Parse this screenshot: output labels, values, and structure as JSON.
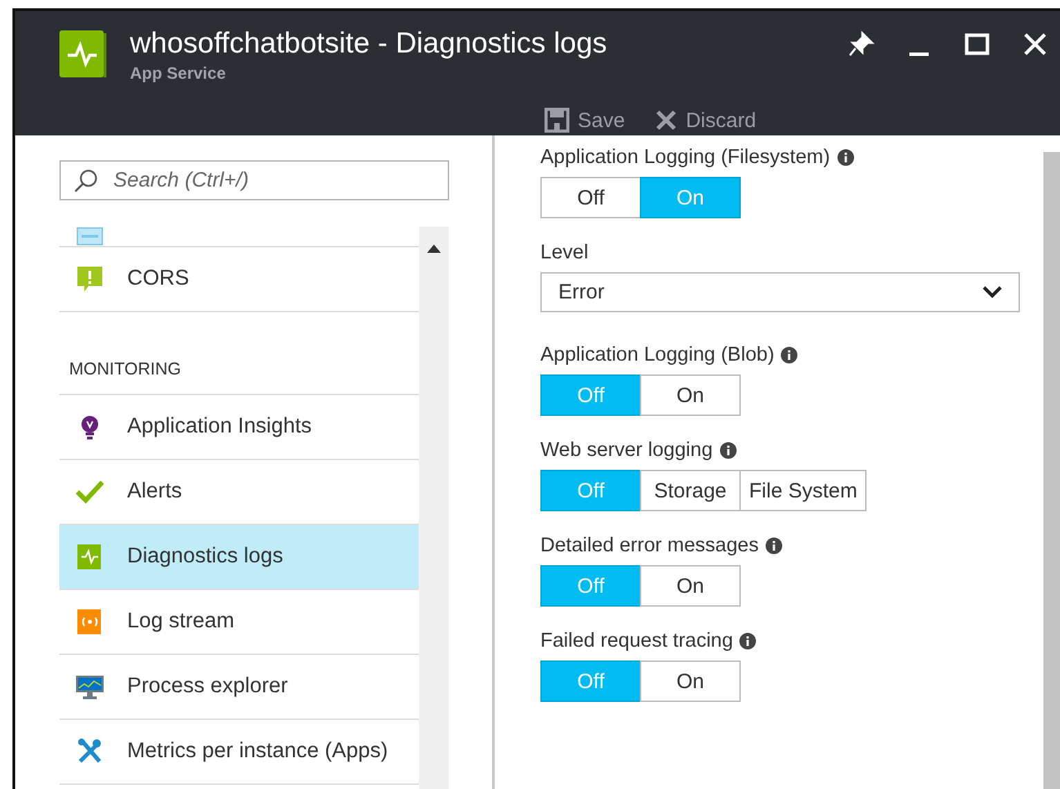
{
  "window": {
    "title": "whosoffchatbotsite - Diagnostics logs",
    "subtitle": "App Service"
  },
  "toolbar": [
    {
      "kind": "save",
      "label": "Save"
    },
    {
      "kind": "discard",
      "label": "Discard"
    }
  ],
  "sidebar": {
    "search": {
      "placeholder": "Search (Ctrl+/)"
    },
    "items": [
      {
        "kind": "item",
        "selected": false
      },
      {
        "kind": "item",
        "label": "CORS",
        "selected": false
      },
      {
        "kind": "header",
        "label": "MONITORING"
      },
      {
        "kind": "item",
        "label": "Application Insights",
        "selected": false
      },
      {
        "kind": "item",
        "label": "Alerts",
        "selected": false
      },
      {
        "kind": "item",
        "label": "Diagnostics logs",
        "selected": true
      },
      {
        "kind": "item",
        "label": "Log stream",
        "selected": false
      },
      {
        "kind": "item",
        "label": "Process explorer",
        "selected": false
      },
      {
        "kind": "item",
        "label": "Metrics per instance (Apps)",
        "selected": false
      }
    ]
  },
  "settings": [
    {
      "kind": "toggle",
      "label": "Application Logging (Filesystem)",
      "info": true,
      "options": [
        {
          "label": "Off",
          "selected": false
        },
        {
          "label": "On",
          "selected": true
        }
      ]
    },
    {
      "kind": "dropdown",
      "label": "Level",
      "value": "Error"
    },
    {
      "kind": "toggle",
      "label": "Application Logging (Blob)",
      "info": true,
      "options": [
        {
          "label": "Off",
          "selected": true
        },
        {
          "label": "On",
          "selected": false
        }
      ]
    },
    {
      "kind": "toggle",
      "label": "Web server logging",
      "info": true,
      "options": [
        {
          "label": "Off",
          "selected": true
        },
        {
          "label": "Storage",
          "selected": false
        },
        {
          "label": "File System",
          "selected": false
        }
      ]
    },
    {
      "kind": "toggle",
      "label": "Detailed error messages",
      "info": true,
      "options": [
        {
          "label": "Off",
          "selected": true
        },
        {
          "label": "On",
          "selected": false
        }
      ]
    },
    {
      "kind": "toggle",
      "label": "Failed request tracing",
      "info": true,
      "options": [
        {
          "label": "Off",
          "selected": true
        },
        {
          "label": "On",
          "selected": false
        }
      ]
    }
  ]
}
